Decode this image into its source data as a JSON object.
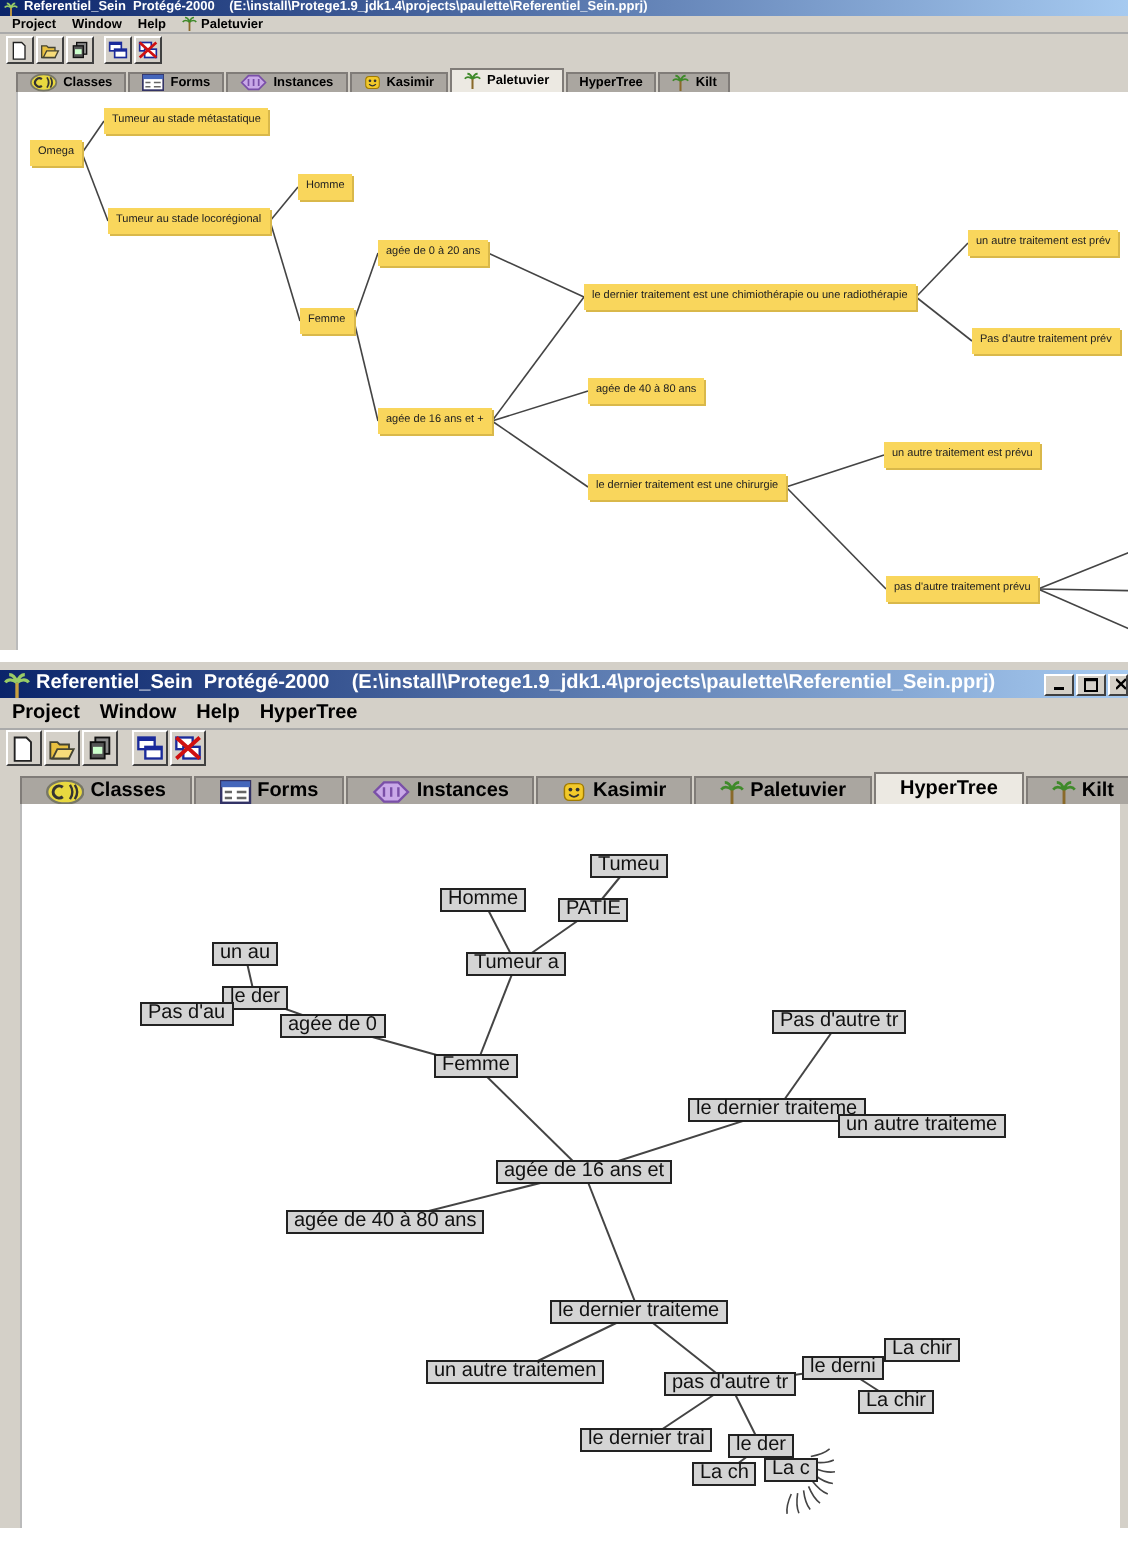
{
  "windows": [
    {
      "kind": "paletuvier",
      "title": "Referentiel_Sein  Protégé-2000    (E:\\install\\Protege1.9_jdk1.4\\projects\\paulette\\Referentiel_Sein.pprj)",
      "menu": [
        {
          "label": "Project",
          "kind": "text"
        },
        {
          "label": "Window",
          "kind": "text"
        },
        {
          "label": "Help",
          "kind": "text"
        },
        {
          "label": "Paletuvier",
          "kind": "plugin"
        }
      ],
      "tabs": [
        {
          "label": "Classes",
          "selected": false
        },
        {
          "label": "Forms",
          "selected": false
        },
        {
          "label": "Instances",
          "selected": false
        },
        {
          "label": "Kasimir",
          "selected": false
        },
        {
          "label": "Paletuvier",
          "selected": true
        },
        {
          "label": "HyperTree",
          "selected": false
        },
        {
          "label": "Kilt",
          "selected": false
        }
      ],
      "tree": {
        "label": "Omega",
        "children": [
          {
            "label": "Tumeur au stade métastatique"
          },
          {
            "label": "Tumeur au stade locorégional",
            "children": [
              {
                "label": "Homme"
              },
              {
                "label": "Femme",
                "children": [
                  {
                    "label": "agée de 0 à 20 ans",
                    "children": [
                      {
                        "label": "le dernier traitement est une chimiothérapie ou une radiothérapie",
                        "children": [
                          {
                            "label": "un autre traitement est prév"
                          },
                          {
                            "label": "Pas d'autre traitement prév"
                          }
                        ]
                      }
                    ]
                  },
                  {
                    "label": "agée de 16 ans et +",
                    "children": [
                      {
                        "label": "agée de 40 à 80 ans"
                      },
                      {
                        "label": "le dernier traitement est une chirurgie",
                        "children": [
                          {
                            "label": "un autre traitement est prévu"
                          },
                          {
                            "label": "pas d'autre traitement prévu"
                          }
                        ]
                      }
                    ]
                  }
                ]
              }
            ]
          }
        ]
      }
    },
    {
      "kind": "hypertree",
      "title": "Referentiel_Sein  Protégé-2000    (E:\\install\\Protege1.9_jdk1.4\\projects\\paulette\\Referentiel_Sein.pprj)",
      "menu": [
        {
          "label": "Project",
          "kind": "text"
        },
        {
          "label": "Window",
          "kind": "text"
        },
        {
          "label": "Help",
          "kind": "text"
        },
        {
          "label": "HyperTree",
          "kind": "text"
        }
      ],
      "tabs": [
        {
          "label": "Classes",
          "selected": false
        },
        {
          "label": "Forms",
          "selected": false
        },
        {
          "label": "Instances",
          "selected": false
        },
        {
          "label": "Kasimir",
          "selected": false
        },
        {
          "label": "Paletuvier",
          "selected": false
        },
        {
          "label": "HyperTree",
          "selected": true
        },
        {
          "label": "Kilt",
          "selected": false
        }
      ],
      "tree": {
        "label": "PATIE",
        "children": [
          {
            "label": "Tumeu"
          },
          {
            "label": "Tumeur a",
            "children": [
              {
                "label": "Homme"
              },
              {
                "label": "Femme",
                "children": [
                  {
                    "label": "agée de 0",
                    "children": [
                      {
                        "label": "le der",
                        "children": [
                          {
                            "label": "un au"
                          },
                          {
                            "label": "Pas d'au"
                          }
                        ]
                      }
                    ]
                  },
                  {
                    "label": "agée de 16 ans et",
                    "children": [
                      {
                        "label": "le dernier traiteme",
                        "children": [
                          {
                            "label": "Pas d'autre tr"
                          },
                          {
                            "label": "un autre traiteme"
                          }
                        ]
                      },
                      {
                        "label": "agée de 40 à 80 ans"
                      },
                      {
                        "label": "le dernier traiteme",
                        "children": [
                          {
                            "label": "un autre traitemen"
                          },
                          {
                            "label": "pas d'autre tr",
                            "children": [
                              {
                                "label": "le derni",
                                "children": [
                                  {
                                    "label": "La chir"
                                  },
                                  {
                                    "label": "La chir"
                                  }
                                ]
                              },
                              {
                                "label": "le dernier trai"
                              },
                              {
                                "label": "le der",
                                "children": [
                                  {
                                    "label": "La ch"
                                  },
                                  {
                                    "label": "La c"
                                  }
                                ]
                              }
                            ]
                          }
                        ]
                      }
                    ]
                  }
                ]
              }
            ]
          }
        ]
      }
    }
  ]
}
